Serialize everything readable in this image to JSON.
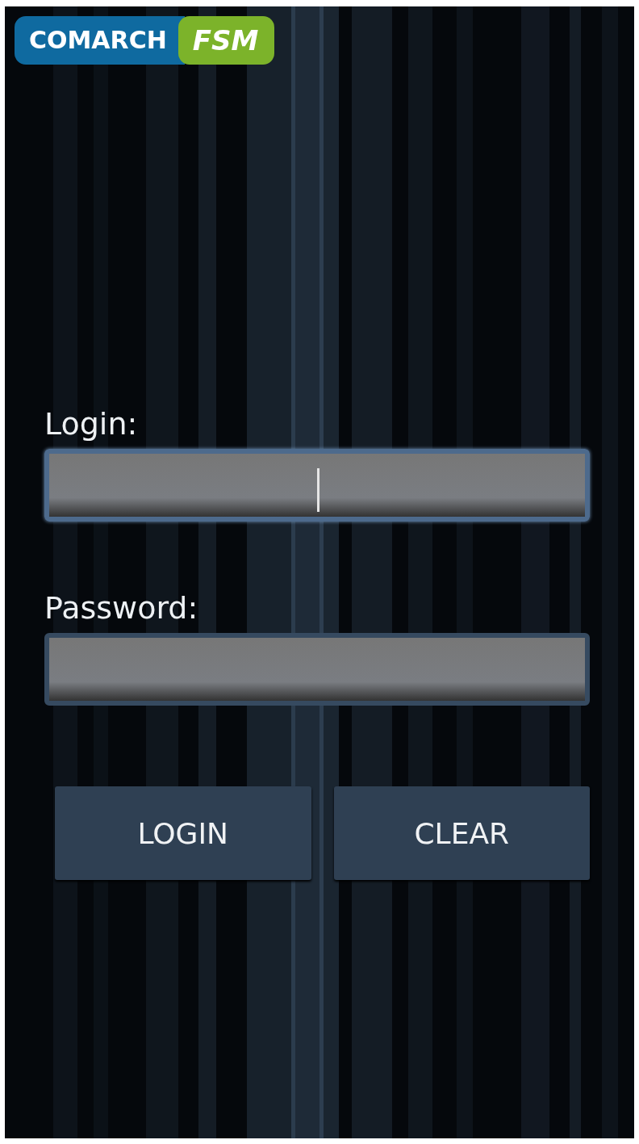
{
  "logo": {
    "brand": "COMARCH",
    "product": "FSM"
  },
  "fields": [
    {
      "label": "Login:",
      "focused": true
    },
    {
      "label": "Password:",
      "focused": false
    }
  ],
  "buttons": [
    {
      "label": "LOGIN"
    },
    {
      "label": "CLEAR"
    }
  ]
}
